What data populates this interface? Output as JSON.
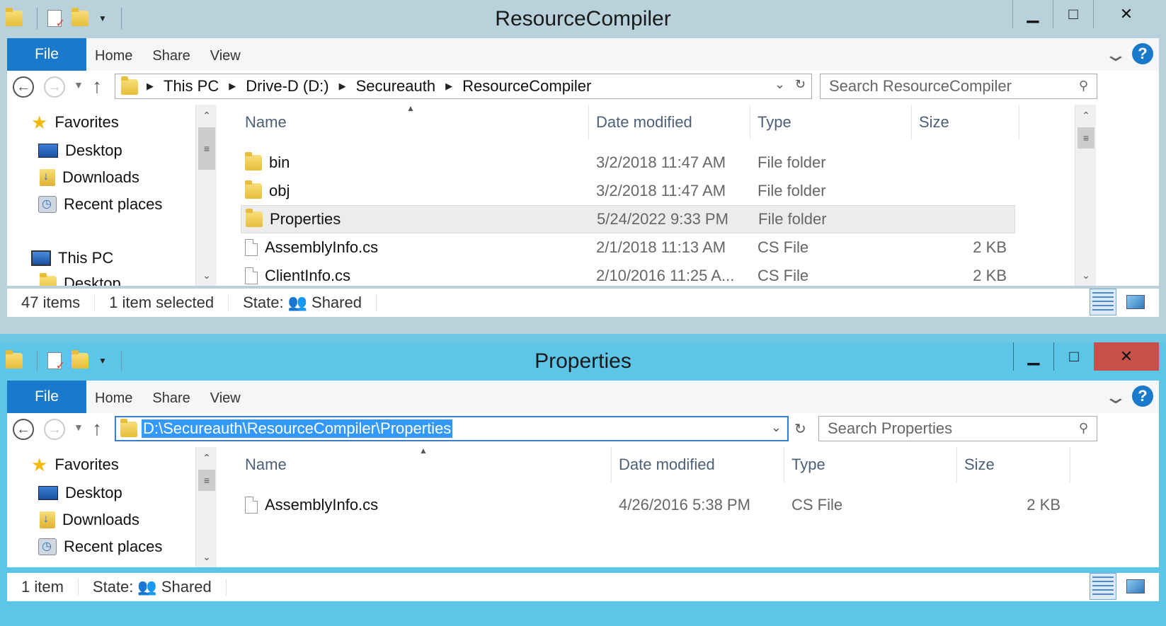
{
  "top_window": {
    "title": "ResourceCompiler",
    "ribbon_tabs": [
      "File",
      "Home",
      "Share",
      "View"
    ],
    "address": {
      "crumbs": [
        "This PC",
        "Drive-D (D:)",
        "Secureauth",
        "ResourceCompiler"
      ]
    },
    "search_placeholder": "Search ResourceCompiler",
    "nav_tree": [
      {
        "label": "Favorites",
        "icon": "star-icon"
      },
      {
        "label": "Desktop",
        "icon": "desktop-icon"
      },
      {
        "label": "Downloads",
        "icon": "downloads-icon"
      },
      {
        "label": "Recent places",
        "icon": "recent-places-icon"
      },
      {
        "label": "This PC",
        "icon": "this-pc-icon"
      },
      {
        "label": "Desktop",
        "icon": "folder-icon"
      }
    ],
    "columns": [
      "Name",
      "Date modified",
      "Type",
      "Size"
    ],
    "files": [
      {
        "name": "bin",
        "date": "3/2/2018 11:47 AM",
        "type": "File folder",
        "size": "",
        "kind": "folder",
        "selected": false
      },
      {
        "name": "obj",
        "date": "3/2/2018 11:47 AM",
        "type": "File folder",
        "size": "",
        "kind": "folder",
        "selected": false
      },
      {
        "name": "Properties",
        "date": "5/24/2022 9:33 PM",
        "type": "File folder",
        "size": "",
        "kind": "folder",
        "selected": true
      },
      {
        "name": "AssemblyInfo.cs",
        "date": "2/1/2018 11:13 AM",
        "type": "CS File",
        "size": "2 KB",
        "kind": "file",
        "selected": false
      },
      {
        "name": "ClientInfo.cs",
        "date": "2/10/2016 11:25 A...",
        "type": "CS File",
        "size": "2 KB",
        "kind": "file",
        "selected": false
      }
    ],
    "status": {
      "count": "47 items",
      "selected": "1 item selected",
      "state_label": "State:",
      "state_value": "Shared"
    }
  },
  "bottom_window": {
    "title": "Properties",
    "ribbon_tabs": [
      "File",
      "Home",
      "Share",
      "View"
    ],
    "address_path": "D:\\Secureauth\\ResourceCompiler\\Properties",
    "search_placeholder": "Search Properties",
    "nav_tree": [
      {
        "label": "Favorites",
        "icon": "star-icon"
      },
      {
        "label": "Desktop",
        "icon": "desktop-icon"
      },
      {
        "label": "Downloads",
        "icon": "downloads-icon"
      },
      {
        "label": "Recent places",
        "icon": "recent-places-icon"
      }
    ],
    "columns": [
      "Name",
      "Date modified",
      "Type",
      "Size"
    ],
    "files": [
      {
        "name": "AssemblyInfo.cs",
        "date": "4/26/2016 5:38 PM",
        "type": "CS File",
        "size": "2 KB",
        "kind": "file",
        "selected": false
      }
    ],
    "status": {
      "count": "1 item",
      "state_label": "State:",
      "state_value": "Shared"
    }
  },
  "window_controls": {
    "minimize": "▁",
    "maximize": "□",
    "close": "✕",
    "help": "?"
  },
  "colors": {
    "accent": "#1979ca",
    "close_hover": "#c7504a",
    "active_frame": "#5dc6e8",
    "inactive_frame": "#b9d1db",
    "selection": "#3399ff"
  }
}
